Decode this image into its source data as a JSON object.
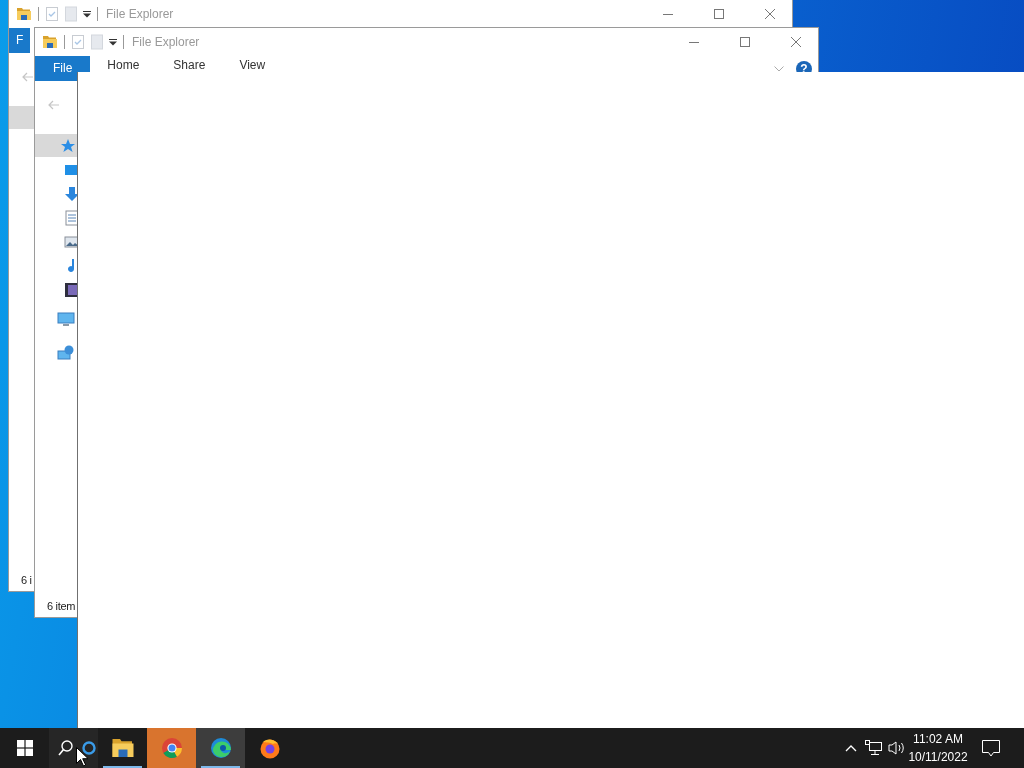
{
  "windows": [
    {
      "title": "File Explorer",
      "tabs": [
        {
          "label": "F",
          "kind": "file"
        }
      ],
      "nav_items": [
        {
          "kind": "blank",
          "selected": true
        }
      ],
      "status": "6 i"
    },
    {
      "title": "File Explorer",
      "tabs": [
        {
          "label": "File",
          "kind": "file"
        },
        {
          "label": "Home",
          "kind": "tab"
        },
        {
          "label": "Share",
          "kind": "tab"
        },
        {
          "label": "View",
          "kind": "tab"
        }
      ],
      "ribbon_right": {
        "help": "?"
      },
      "nav_items": [
        {
          "kind": "quick_access",
          "selected": true,
          "children": [
            {
              "kind": "desktop",
              "selected": false
            },
            {
              "kind": "downloads",
              "selected": false
            },
            {
              "kind": "documents",
              "selected": false
            },
            {
              "kind": "pictures",
              "selected": false
            },
            {
              "kind": "music",
              "selected": false
            },
            {
              "kind": "videos",
              "selected": false
            }
          ]
        },
        {
          "kind": "this_pc",
          "selected": false
        },
        {
          "kind": "network",
          "selected": false
        }
      ],
      "status": "6 item"
    }
  ],
  "taskbar": {
    "apps": [
      {
        "kind": "explorer",
        "running": true,
        "flashing": false,
        "active": false
      },
      {
        "kind": "chrome",
        "running": false,
        "flashing": true,
        "active": false
      },
      {
        "kind": "edge",
        "running": true,
        "flashing": false,
        "active": true
      },
      {
        "kind": "firefox",
        "running": false,
        "flashing": false,
        "active": false
      }
    ],
    "time": "11:02 AM",
    "date": "10/11/2022"
  }
}
